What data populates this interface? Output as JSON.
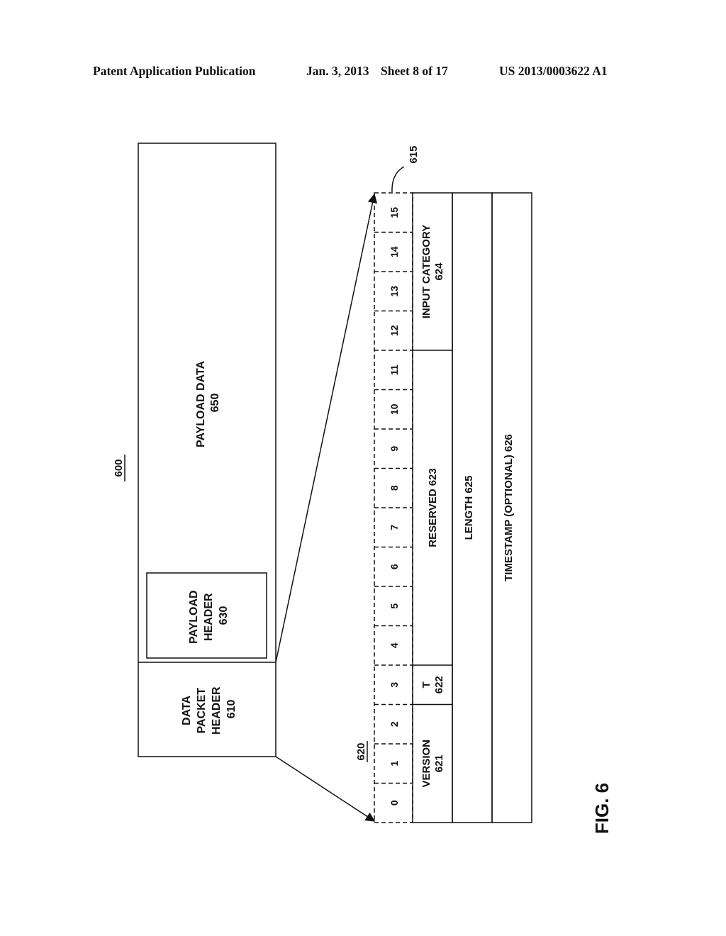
{
  "header": {
    "publication": "Patent Application Publication",
    "date": "Jan. 3, 2013",
    "sheet": "Sheet 8 of 17",
    "patent_number": "US 2013/0003622 A1"
  },
  "figure": {
    "label": "FIG. 6",
    "packet_ref": "600",
    "packet": {
      "data_packet_header": {
        "lines": [
          "DATA",
          "PACKET",
          "HEADER",
          "610"
        ]
      },
      "payload_header": {
        "lines": [
          "PAYLOAD",
          "HEADER",
          "630"
        ]
      },
      "payload_data": {
        "lines": [
          "PAYLOAD DATA",
          "650"
        ]
      }
    },
    "header_detail": {
      "ref": "620",
      "bit_row_ref": "615",
      "bits": [
        "0",
        "1",
        "2",
        "3",
        "4",
        "5",
        "6",
        "7",
        "8",
        "9",
        "10",
        "11",
        "12",
        "13",
        "14",
        "15"
      ],
      "row1_fields": [
        {
          "lines": [
            "VERSION",
            "621"
          ],
          "bit_start": 0,
          "bit_end": 2
        },
        {
          "lines": [
            "T",
            "622"
          ],
          "bit_start": 3,
          "bit_end": 3
        },
        {
          "lines": [
            "RESERVED 623"
          ],
          "bit_start": 4,
          "bit_end": 11
        },
        {
          "lines": [
            "INPUT CATEGORY",
            "624"
          ],
          "bit_start": 12,
          "bit_end": 15
        }
      ],
      "row2_field": {
        "lines": [
          "LENGTH 625"
        ]
      },
      "row3_field": {
        "lines": [
          "TIMESTAMP (OPTIONAL) 626"
        ]
      }
    }
  }
}
